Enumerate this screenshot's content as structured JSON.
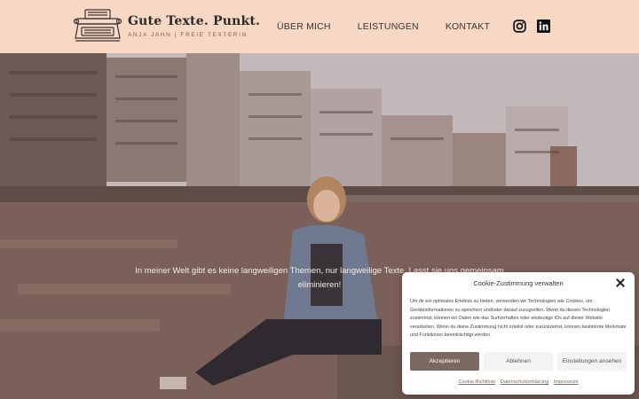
{
  "header": {
    "logo_title": "Gute Texte. Punkt.",
    "logo_subtitle": "ANJA JAHN | FREIE TEXTERIN",
    "nav": [
      "ÜBER MICH",
      "LEISTUNGEN",
      "KONTAKT"
    ],
    "social_icons": [
      "instagram-icon",
      "linkedin-icon"
    ]
  },
  "hero": {
    "tagline_line1": "In meiner Welt gibt es keine langweiligen Themen, nur langweilige Texte. Lasst sie uns gemeinsam",
    "tagline_line2": "eliminieren!"
  },
  "cookie": {
    "title": "Cookie-Zustimmung verwalten",
    "body": "Um dir ein optimales Erlebnis zu bieten, verwenden wir Technologien wie Cookies, um Geräteinformationen zu speichern und/oder darauf zuzugreifen. Wenn du diesen Technologien zustimmst, können wir Daten wie das Surfverhalten oder eindeutige IDs auf dieser Website verarbeiten. Wenn du deine Zustimmung nicht erteilst oder zurückziehst, können bestimmte Merkmale und Funktionen beeinträchtigt werden.",
    "accept": "Akzeptieren",
    "deny": "Ablehnen",
    "settings": "Einstellungen ansehen",
    "links": [
      "Cookie Richtlinie",
      "Datenschutzerklärung",
      "Impressum"
    ]
  },
  "colors": {
    "header_bg": "#f7d8c5",
    "accent": "#7b6860"
  }
}
